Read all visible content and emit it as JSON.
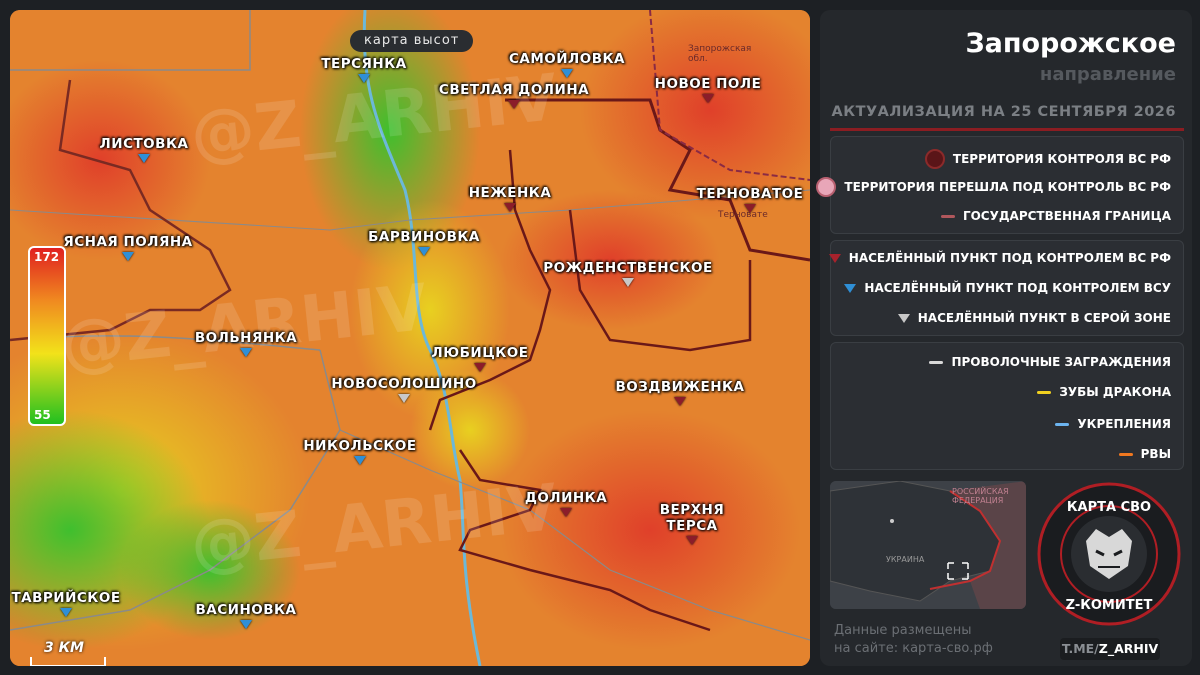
{
  "map": {
    "title": "карта высот",
    "watermark": "@Z_ARHIV",
    "elevation_max": "172",
    "elevation_min": "55",
    "scale_label": "3 КМ",
    "border_small_label": "Запорожская обл.",
    "settlements_small_label": "Терновате",
    "places": [
      {
        "name": "ТЕРСЯНКА",
        "status": "ua"
      },
      {
        "name": "САМОЙЛОВКА",
        "status": "ua"
      },
      {
        "name": "СВЕТЛАЯ ДОЛИНА",
        "status": "ru"
      },
      {
        "name": "НОВОЕ ПОЛЕ",
        "status": "ru"
      },
      {
        "name": "ЛИСТОВКА",
        "status": "ua"
      },
      {
        "name": "НЕЖЕНКА",
        "status": "ru"
      },
      {
        "name": "ТЕРНОВАТОЕ",
        "status": "ru"
      },
      {
        "name": "ЯСНАЯ ПОЛЯНА",
        "status": "ua"
      },
      {
        "name": "БАРВИНОВКА",
        "status": "ua"
      },
      {
        "name": "РОЖДЕНСТВЕНСКОЕ",
        "status": "gray"
      },
      {
        "name": "ВОЛЬНЯНКА",
        "status": "ua"
      },
      {
        "name": "ЛЮБИЦКОЕ",
        "status": "ru"
      },
      {
        "name": "НОВОСОЛОШИНО",
        "status": "gray"
      },
      {
        "name": "ВОЗДВИЖЕНКА",
        "status": "ru"
      },
      {
        "name": "НИКОЛЬСКОЕ",
        "status": "ua"
      },
      {
        "name": "ДОЛИНКА",
        "status": "ru"
      },
      {
        "name": "ВЕРХНЯ ТЕРСА",
        "status": "ru"
      },
      {
        "name": "ТАВРИЙСКОЕ",
        "status": "ua"
      },
      {
        "name": "ВАСИНОВКА",
        "status": "ua"
      }
    ]
  },
  "panel": {
    "title": "Запорожское",
    "subtitle": "направление",
    "date": "АКТУАЛИЗАЦИЯ НА 25 СЕНТЯБРЯ 2026",
    "legend_territory": [
      {
        "label": "ТЕРРИТОРИЯ КОНТРОЛЯ ВС РФ",
        "color": "#5a1518"
      },
      {
        "label": "ТЕРРИТОРИЯ ПЕРЕШЛА ПОД КОНТРОЛЬ ВС РФ",
        "color": "#e8a6b8"
      },
      {
        "label": "ГОСУДАРСТВЕННАЯ ГРАНИЦА",
        "color": "#b0575c"
      }
    ],
    "legend_settlements": [
      {
        "label": "НАСЕЛЁННЫЙ ПУНКТ ПОД КОНТРОЛЕМ ВС РФ",
        "color": "#a8222c"
      },
      {
        "label": "НАСЕЛЁННЫЙ ПУНКТ ПОД КОНТРОЛЕМ ВСУ",
        "color": "#2f8fd6"
      },
      {
        "label": "НАСЕЛЁННЫЙ ПУНКТ В СЕРОЙ ЗОНЕ",
        "color": "#c8c8c8"
      }
    ],
    "legend_fortifications": [
      {
        "label": "ПРОВОЛОЧНЫЕ ЗАГРАЖДЕНИЯ",
        "color": "#d8d8d8"
      },
      {
        "label": "ЗУБЫ ДРАКОНА",
        "color": "#f0d020"
      },
      {
        "label": "УКРЕПЛЕНИЯ",
        "color": "#6cb4f0"
      },
      {
        "label": "РВЫ",
        "color": "#f07820"
      }
    ],
    "minimap": {
      "country_ua": "УКРАИНА",
      "country_ru": "РОССИЙСКАЯ ФЕДЕРАЦИЯ"
    },
    "site_line1": "Данные размещены",
    "site_line2": "на сайте: карта-сво.рф",
    "tg_prefix": "T.ME/",
    "tg_handle": "Z_ARHIV",
    "emblem_top": "КАРТА СВО",
    "emblem_bottom": "Z-КОМИТЕТ"
  },
  "colors": {
    "ru_control": "#5a1518",
    "ua": "#2f8fd6",
    "gray": "#c8c8c8",
    "accent": "#8b1d22"
  }
}
